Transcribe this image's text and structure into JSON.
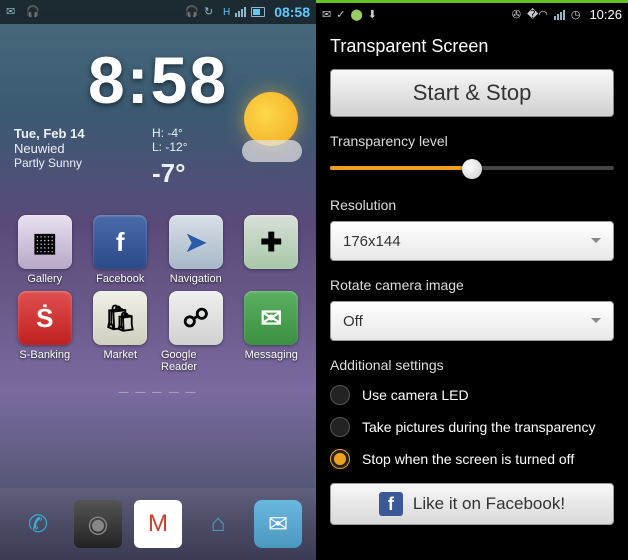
{
  "left": {
    "status": {
      "time": "08:58",
      "network": "H"
    },
    "clock": "8:58",
    "weather": {
      "date": "Tue, Feb 14",
      "city": "Neuwied",
      "cond": "Partly Sunny",
      "high_label": "H:",
      "high": "-4°",
      "low_label": "L:",
      "low": "-12°",
      "temp": "-7°"
    },
    "apps": [
      {
        "label": "Gallery",
        "cls": "ic-gallery",
        "glyph": "▦"
      },
      {
        "label": "Facebook",
        "cls": "ic-fb",
        "glyph": "f"
      },
      {
        "label": "Navigation",
        "cls": "ic-nav",
        "glyph": "➤"
      },
      {
        "label": "",
        "cls": "ic-droid",
        "glyph": "✚"
      },
      {
        "label": "S-Banking",
        "cls": "ic-sb",
        "glyph": "Ṡ"
      },
      {
        "label": "Market",
        "cls": "ic-market",
        "glyph": "🛍"
      },
      {
        "label": "Google Reader",
        "cls": "ic-reader",
        "glyph": "☍"
      },
      {
        "label": "Messaging",
        "cls": "ic-msg",
        "glyph": "✉"
      }
    ],
    "dock": [
      {
        "name": "phone",
        "cls": "d-phone",
        "glyph": "✆"
      },
      {
        "name": "camera",
        "cls": "d-cam",
        "glyph": "◉"
      },
      {
        "name": "gmail",
        "cls": "d-gmail",
        "glyph": "M"
      },
      {
        "name": "browser",
        "cls": "d-dolphin",
        "glyph": "⌂"
      },
      {
        "name": "sms",
        "cls": "d-sms",
        "glyph": "✉"
      }
    ]
  },
  "right": {
    "status": {
      "time": "10:26"
    },
    "title": "Transparent Screen",
    "start_stop": "Start & Stop",
    "transparency_label": "Transparency level",
    "transparency_pct": 50,
    "resolution_label": "Resolution",
    "resolution_value": "176x144",
    "rotate_label": "Rotate camera image",
    "rotate_value": "Off",
    "additional_label": "Additional settings",
    "opts": [
      {
        "label": "Use camera LED",
        "checked": false
      },
      {
        "label": "Take pictures during the transparency",
        "checked": false
      },
      {
        "label": "Stop when the screen is turned off",
        "checked": true
      }
    ],
    "fb_label": "Like it on Facebook!"
  }
}
